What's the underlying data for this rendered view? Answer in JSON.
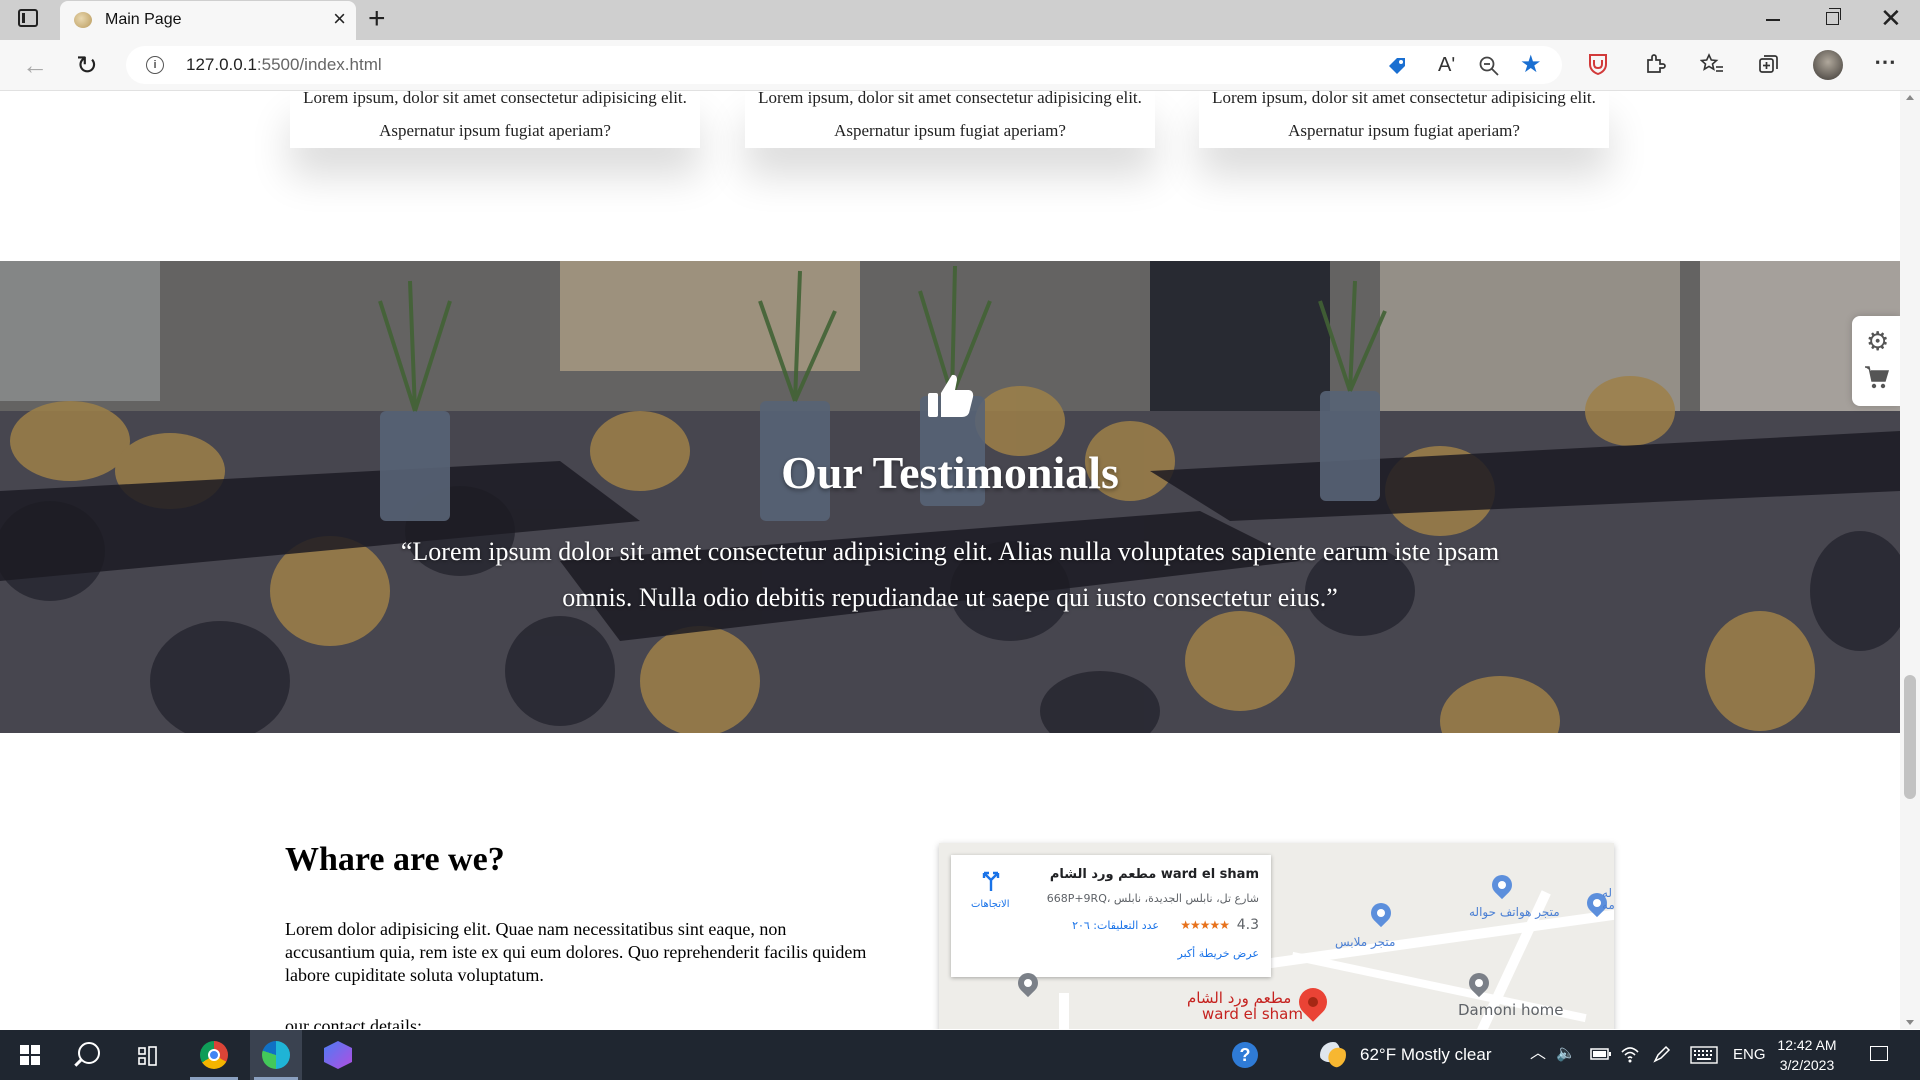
{
  "browser": {
    "tab_title": "Main Page",
    "tab_close": "×",
    "new_tab": "+",
    "url_host": "127.0.0.1",
    "url_rest": ":5500/index.html",
    "read_aloud": "Aʹ",
    "more": "⋯"
  },
  "page": {
    "cards": [
      {
        "text": "Lorem ipsum, dolor sit amet consectetur adipisicing elit. Aspernatur ipsum fugiat aperiam?"
      },
      {
        "text": "Lorem ipsum, dolor sit amet consectetur adipisicing elit. Aspernatur ipsum fugiat aperiam?"
      },
      {
        "text": "Lorem ipsum, dolor sit amet consectetur adipisicing elit. Aspernatur ipsum fugiat aperiam?"
      }
    ],
    "testimonials": {
      "title": "Our Testimonials",
      "quote": "“Lorem ipsum dolor sit amet consectetur adipisicing elit. Alias nulla voluptates sapiente earum iste ipsam omnis. Nulla odio debitis repudiandae ut saepe qui iusto consectetur eius.”"
    },
    "where": {
      "title": "Whare are we?",
      "text": "Lorem dolor adipisicing elit. Quae nam necessitatibus sint eaque, non accusantium quia, rem iste ex qui eum dolores. Quo reprehenderit facilis quidem labore cupiditate soluta voluptatum.",
      "contact_label": "our contact details:"
    },
    "map": {
      "place_name": "مطعم ورد الشام ward el sham",
      "address": "668P+9RQ، شارع تل، نابلس الجديدة، نابلس",
      "rating": "4.3",
      "stars": "★★★★★",
      "reviews": "عدد التعليقات: ٢٠٦",
      "view_larger": "عرض خريطة أكبر",
      "directions": "الاتجاهات",
      "poi_phones": "متجر هواتف حواله",
      "poi_clothes": "متجر ملابس",
      "poi_partial": "له\nمه",
      "marker_ar": "مطعم ورد الشام",
      "marker_en": "ward el sham",
      "poi_damoni": "Damoni home"
    }
  },
  "taskbar": {
    "weather": "62°F  Mostly clear",
    "lang": "ENG",
    "time": "12:42 AM",
    "date": "3/2/2023"
  },
  "colors": {
    "taskbar_bg": "#1f2630",
    "map_link": "#1a73e8",
    "marker_red": "#ea4335",
    "star": "#e7711b"
  }
}
